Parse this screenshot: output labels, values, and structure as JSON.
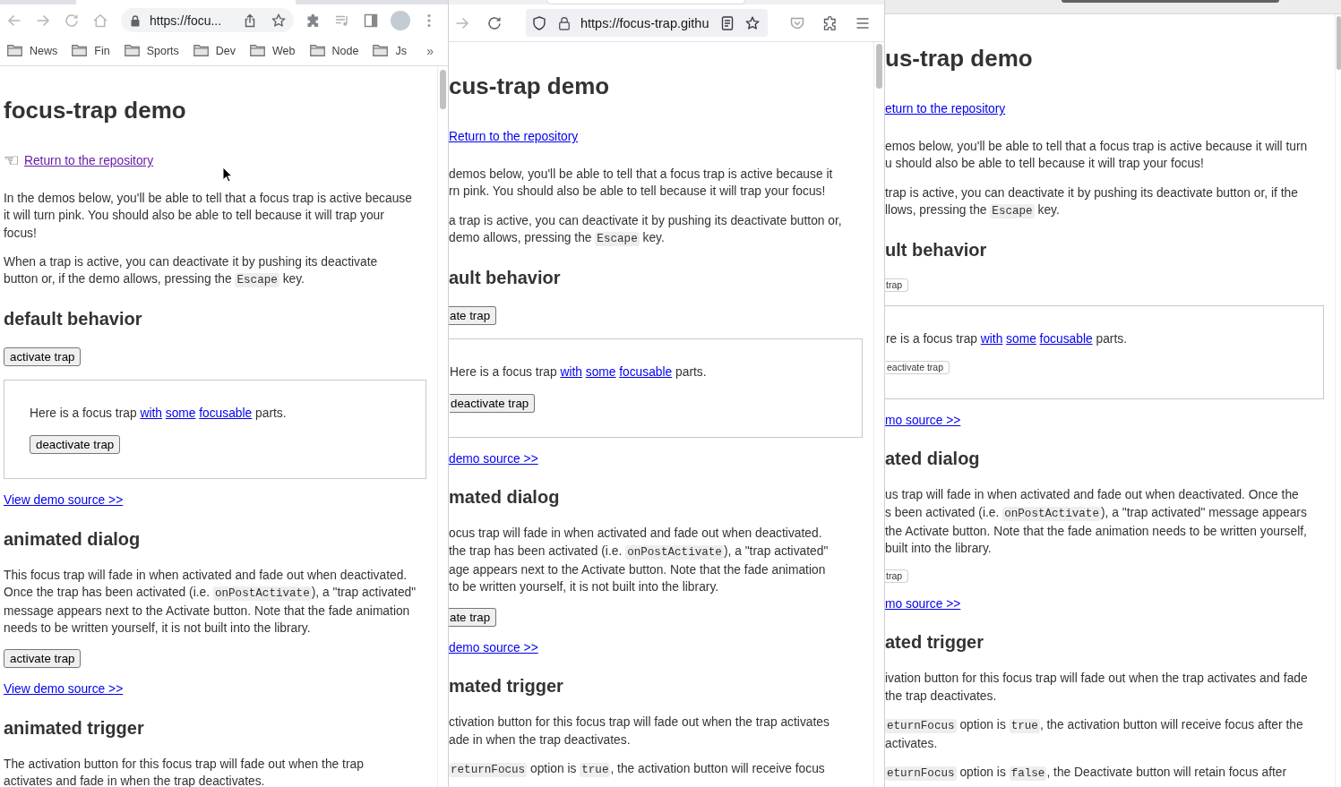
{
  "windows": [
    {
      "kind": "chrome",
      "address": "https://focu...",
      "bookmarks": [
        {
          "label": "News"
        },
        {
          "label": "Fin"
        },
        {
          "label": "Sports"
        },
        {
          "label": "Dev"
        },
        {
          "label": "Web"
        },
        {
          "label": "Node"
        },
        {
          "label": "Js"
        }
      ],
      "bookmarks_more": "»",
      "page": [
        {
          "kind": "h1",
          "text": "focus-trap demo"
        },
        {
          "kind": "return_link",
          "icon": "☜",
          "text": "Return to the repository",
          "visited": true
        },
        {
          "kind": "para",
          "lines": [
            [
              {
                "kind": "text",
                "text": "In the demos below, you'll be able to tell that a focus trap is active because"
              }
            ],
            [
              {
                "kind": "text",
                "text": "it will turn pink. You should also be able to tell because it will trap your"
              }
            ],
            [
              {
                "kind": "text",
                "text": "focus!"
              }
            ]
          ]
        },
        {
          "kind": "para",
          "lines": [
            [
              {
                "kind": "text",
                "text": "When a trap is active, you can deactivate it by pushing its deactivate"
              }
            ],
            [
              {
                "kind": "text",
                "text": "button or, if the demo allows, pressing the "
              },
              {
                "kind": "code",
                "text": "Escape"
              },
              {
                "kind": "text",
                "text": " key."
              }
            ]
          ]
        },
        {
          "kind": "h2",
          "text": "default behavior"
        },
        {
          "kind": "button",
          "text": "activate trap"
        },
        {
          "kind": "trap",
          "lines": [
            [
              {
                "kind": "text",
                "text": "Here is a focus trap "
              },
              {
                "kind": "link",
                "text": "with"
              },
              {
                "kind": "link",
                "text": "some"
              },
              {
                "kind": "link",
                "text": "focusable"
              },
              {
                "kind": "text",
                "text": " parts."
              }
            ]
          ],
          "button": "deactivate trap"
        },
        {
          "kind": "link",
          "text": "View demo source >>",
          "visited": false
        },
        {
          "kind": "h2",
          "text": "animated dialog"
        },
        {
          "kind": "para",
          "lines": [
            [
              {
                "kind": "text",
                "text": "This focus trap will fade in when activated and fade out when deactivated."
              }
            ],
            [
              {
                "kind": "text",
                "text": "Once the trap has been activated (i.e. "
              },
              {
                "kind": "code",
                "text": "onPostActivate"
              },
              {
                "kind": "text",
                "text": "), a \"trap activated\""
              }
            ],
            [
              {
                "kind": "text",
                "text": "message appears next to the Activate button. Note that the fade animation"
              }
            ],
            [
              {
                "kind": "text",
                "text": "needs to be written yourself, it is not built into the library."
              }
            ]
          ]
        },
        {
          "kind": "button",
          "text": "activate trap"
        },
        {
          "kind": "link",
          "text": "View demo source >>",
          "visited": false
        },
        {
          "kind": "h2",
          "text": "animated trigger"
        },
        {
          "kind": "para",
          "lines": [
            [
              {
                "kind": "text",
                "text": "The activation button for this focus trap will fade out when the trap"
              }
            ],
            [
              {
                "kind": "text",
                "text": "activates and fade in when the trap deactivates."
              }
            ]
          ]
        }
      ]
    },
    {
      "kind": "firefox",
      "address": "https://focus-trap.githu",
      "page": [
        {
          "kind": "h1",
          "text": "cus-trap demo"
        },
        {
          "kind": "return_link",
          "text": "Return to the repository",
          "visited": false
        },
        {
          "kind": "para",
          "lines": [
            [
              {
                "kind": "text",
                "text": "demos below, you'll be able to tell that a focus trap is active because it"
              }
            ],
            [
              {
                "kind": "text",
                "text": "rn pink. You should also be able to tell because it will trap your focus!"
              }
            ]
          ]
        },
        {
          "kind": "para",
          "lines": [
            [
              {
                "kind": "text",
                "text": "a trap is active, you can deactivate it by pushing its deactivate button or,"
              }
            ],
            [
              {
                "kind": "text",
                "text": "demo allows, pressing the "
              },
              {
                "kind": "code",
                "text": "Escape"
              },
              {
                "kind": "text",
                "text": " key."
              }
            ]
          ]
        },
        {
          "kind": "h2",
          "text": "ault behavior"
        },
        {
          "kind": "button",
          "text": "ate trap"
        },
        {
          "kind": "trap",
          "lines": [
            [
              {
                "kind": "text",
                "text": "Here is a focus trap "
              },
              {
                "kind": "link",
                "text": "with"
              },
              {
                "kind": "link",
                "text": "some"
              },
              {
                "kind": "link",
                "text": "focusable"
              },
              {
                "kind": "text",
                "text": " parts."
              }
            ]
          ],
          "button": "deactivate trap"
        },
        {
          "kind": "link",
          "text": "demo source >>",
          "visited": false
        },
        {
          "kind": "h2",
          "text": "mated dialog"
        },
        {
          "kind": "para",
          "lines": [
            [
              {
                "kind": "text",
                "text": "ocus trap will fade in when activated and fade out when deactivated."
              }
            ],
            [
              {
                "kind": "text",
                "text": "the trap has been activated (i.e. "
              },
              {
                "kind": "code",
                "text": "onPostActivate"
              },
              {
                "kind": "text",
                "text": "), a \"trap activated\""
              }
            ],
            [
              {
                "kind": "text",
                "text": "age appears next to the Activate button. Note that the fade animation"
              }
            ],
            [
              {
                "kind": "text",
                "text": "to be written yourself, it is not built into the library."
              }
            ]
          ]
        },
        {
          "kind": "button",
          "text": "ate trap"
        },
        {
          "kind": "link",
          "text": "demo source >>",
          "visited": false
        },
        {
          "kind": "h2",
          "text": "mated trigger"
        },
        {
          "kind": "para",
          "lines": [
            [
              {
                "kind": "text",
                "text": "ctivation button for this focus trap will fade out when the trap activates"
              }
            ],
            [
              {
                "kind": "text",
                "text": "ade in when the trap deactivates."
              }
            ]
          ]
        },
        {
          "kind": "para",
          "lines": [
            [
              {
                "kind": "code",
                "text": "returnFocus"
              },
              {
                "kind": "text",
                "text": " option is "
              },
              {
                "kind": "code",
                "text": "true"
              },
              {
                "kind": "text",
                "text": ", the activation button will receive focus"
              }
            ]
          ]
        }
      ]
    },
    {
      "kind": "plain",
      "page": [
        {
          "kind": "h1",
          "text": "us-trap demo"
        },
        {
          "kind": "return_link",
          "text": "eturn to the repository",
          "visited": false
        },
        {
          "kind": "para",
          "lines": [
            [
              {
                "kind": "text",
                "text": "emos below, you'll be able to tell that a focus trap is active because it will turn"
              }
            ],
            [
              {
                "kind": "text",
                "text": "u should also be able to tell because it will trap your focus!"
              }
            ]
          ]
        },
        {
          "kind": "para",
          "lines": [
            [
              {
                "kind": "text",
                "text": "trap is active, you can deactivate it by pushing its deactivate button or, if the"
              }
            ],
            [
              {
                "kind": "text",
                "text": "llows, pressing the "
              },
              {
                "kind": "code",
                "text": "Escape"
              },
              {
                "kind": "text",
                "text": " key."
              }
            ]
          ]
        },
        {
          "kind": "h2",
          "text": "ult behavior"
        },
        {
          "kind": "button",
          "text": "trap"
        },
        {
          "kind": "trap",
          "lines": [
            [
              {
                "kind": "text",
                "text": "re is a focus trap "
              },
              {
                "kind": "link",
                "text": "with"
              },
              {
                "kind": "link",
                "text": "some"
              },
              {
                "kind": "link",
                "text": "focusable"
              },
              {
                "kind": "text",
                "text": " parts."
              }
            ]
          ],
          "button": "eactivate trap"
        },
        {
          "kind": "link",
          "text": "mo source >>",
          "visited": false
        },
        {
          "kind": "h2",
          "text": "ated dialog"
        },
        {
          "kind": "para",
          "lines": [
            [
              {
                "kind": "text",
                "text": "us trap will fade in when activated and fade out when deactivated. Once the"
              }
            ],
            [
              {
                "kind": "text",
                "text": "s been activated (i.e. "
              },
              {
                "kind": "code",
                "text": "onPostActivate"
              },
              {
                "kind": "text",
                "text": "), a \"trap activated\" message appears"
              }
            ],
            [
              {
                "kind": "text",
                "text": "the Activate button. Note that the fade animation needs to be written yourself,"
              }
            ],
            [
              {
                "kind": "text",
                "text": "built into the library."
              }
            ]
          ]
        },
        {
          "kind": "button",
          "text": "trap"
        },
        {
          "kind": "link",
          "text": "mo source >>",
          "visited": false
        },
        {
          "kind": "h2",
          "text": "ated trigger"
        },
        {
          "kind": "para",
          "lines": [
            [
              {
                "kind": "text",
                "text": "ivation button for this focus trap will fade out when the trap activates and fade"
              }
            ],
            [
              {
                "kind": "text",
                "text": "the trap deactivates."
              }
            ]
          ]
        },
        {
          "kind": "para",
          "lines": [
            [
              {
                "kind": "code",
                "text": "eturnFocus"
              },
              {
                "kind": "text",
                "text": " option is "
              },
              {
                "kind": "code",
                "text": "true"
              },
              {
                "kind": "text",
                "text": ", the activation button will receive focus after the"
              }
            ],
            [
              {
                "kind": "text",
                "text": "activates."
              }
            ]
          ]
        },
        {
          "kind": "para",
          "lines": [
            [
              {
                "kind": "code",
                "text": "eturnFocus"
              },
              {
                "kind": "text",
                "text": " option is "
              },
              {
                "kind": "code",
                "text": "false"
              },
              {
                "kind": "text",
                "text": ", the Deactivate button will retain focus after"
              }
            ]
          ]
        }
      ]
    }
  ]
}
